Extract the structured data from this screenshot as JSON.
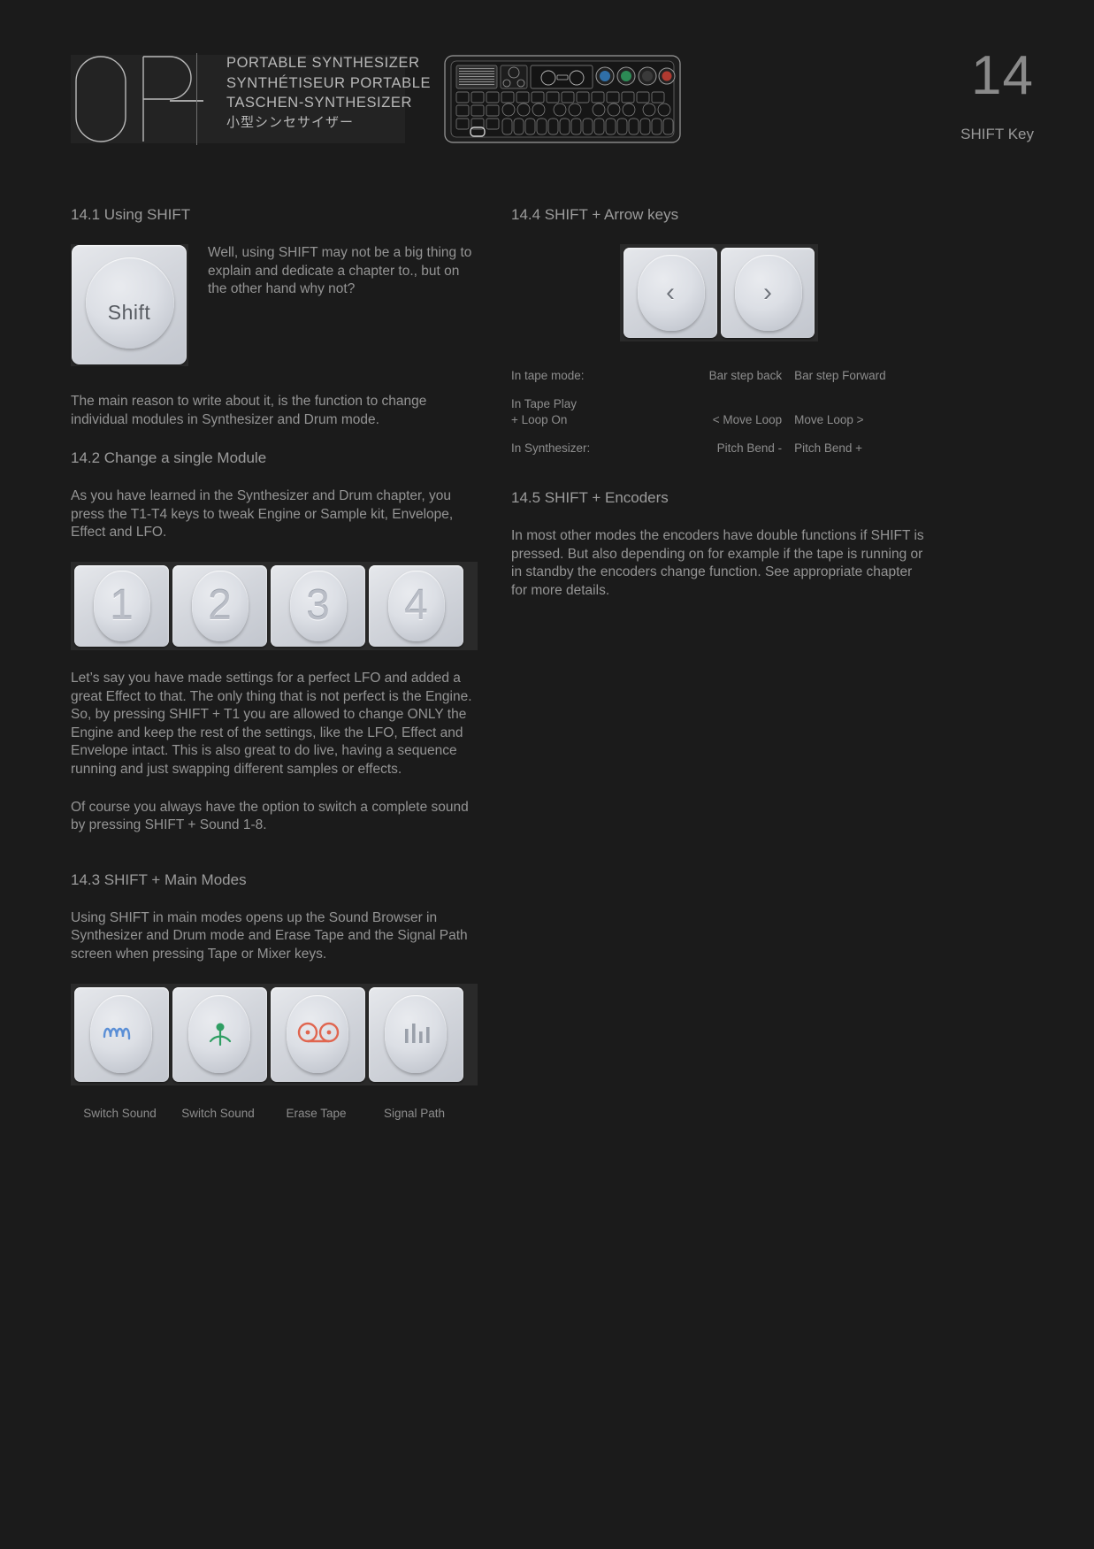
{
  "header": {
    "logo_mark": "OP—",
    "logo_lines": [
      "PORTABLE SYNTHESIZER",
      "SYNTHÉTISEUR  PORTABLE",
      "TASCHEN-SYNTHESIZER",
      "小型シンセサイザー"
    ],
    "device_label": "op-1-device-illustration",
    "chapter_number": "14",
    "chapter_name": "SHIFT Key"
  },
  "left_column": {
    "s1_title": "14.1 Using SHIFT",
    "s1_intro": "Well, using SHIFT may not be a big thing to explain and dedicate a chapter to., but on the other hand why not?",
    "shift_key_label": "Shift",
    "s1_para": "The main reason to write about it, is the function to change individual modules in Synthesizer and Drum mode.",
    "s2_title": "14.2 Change a single Module",
    "s2_para1": "As you have learned in the Synthesizer and Drum chapter, you press the T1-T4 keys to tweak Engine or Sample kit, Envelope, Effect and LFO.",
    "num_keys": [
      "1",
      "2",
      "3",
      "4"
    ],
    "s2_para2": "Let’s say you have made settings for a perfect LFO and added a great Effect to that. The only thing that is not perfect is the Engine. So, by pressing SHIFT + T1 you are allowed to change ONLY the Engine and keep the rest of the settings, like the LFO, Effect and Envelope intact.  This is also great to do live, having a sequence running and just swapping different samples or effects.",
    "s2_para3": "Of course you always have the option to switch a complete sound by pressing SHIFT + Sound 1-8.",
    "s3_title": "14.3  SHIFT + Main Modes",
    "s3_para": "Using SHIFT in main modes opens up the Sound Browser in Synthesizer and Drum mode and Erase Tape and the Signal Path screen when pressing Tape or Mixer keys.",
    "mode_keys": [
      {
        "icon": "synth-wave-icon",
        "color": "#5b8fd6",
        "label": "Switch Sound"
      },
      {
        "icon": "drum-antenna-icon",
        "color": "#2f9e63",
        "label": "Switch Sound"
      },
      {
        "icon": "tape-reels-icon",
        "color": "#e0654f",
        "label": "Erase Tape"
      },
      {
        "icon": "mixer-bars-icon",
        "color": "#9aa0aa",
        "label": "Signal Path"
      }
    ]
  },
  "right_column": {
    "s4_title": "14.4  SHIFT + Arrow keys",
    "arrow_keys": [
      {
        "icon": "chevron-left-icon",
        "glyph": "‹"
      },
      {
        "icon": "chevron-right-icon",
        "glyph": "›"
      }
    ],
    "table": [
      {
        "mode": "In tape mode:",
        "left": "Bar step back",
        "right": "Bar step Forward"
      },
      {
        "mode": "In Tape Play\n+ Loop On",
        "left": "< Move Loop",
        "right": "Move Loop >"
      },
      {
        "mode": "In Synthesizer:",
        "left": "Pitch Bend -",
        "right": "Pitch Bend +"
      }
    ],
    "s5_title": "14.5 SHIFT + Encoders",
    "s5_para": "In most other modes the encoders have double functions if SHIFT is pressed. But also depending on for example if the tape is running or in standby the encoders change function. See appropriate chapter for more details."
  }
}
